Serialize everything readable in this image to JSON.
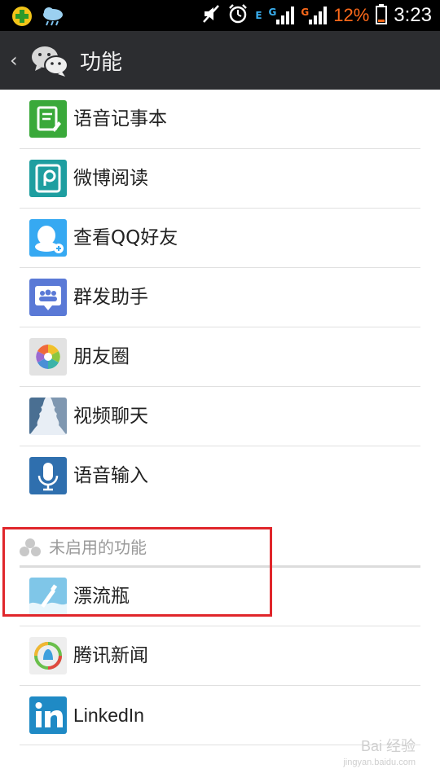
{
  "status_bar": {
    "battery_percent": "12%",
    "time": "3:23",
    "net1": "E",
    "net2": "G",
    "net3": "G",
    "icons": [
      "app-plus-icon",
      "weather-cloud-icon",
      "mute-icon",
      "alarm-icon",
      "signal-icon",
      "battery-icon"
    ],
    "battery_color": "#ff6a1a"
  },
  "action_bar": {
    "back": "‹",
    "title": "功能",
    "logo": "wechat-icon"
  },
  "features": [
    {
      "label": "语音记事本",
      "icon": "voice-notepad-icon",
      "color": "#3aa93a"
    },
    {
      "label": "微博阅读",
      "icon": "weibo-reader-icon",
      "color": "#1e9ea0"
    },
    {
      "label": "查看QQ好友",
      "icon": "qq-friends-icon",
      "color": "#36a9f2"
    },
    {
      "label": "群发助手",
      "icon": "broadcast-helper-icon",
      "color": "#5a79d6"
    },
    {
      "label": "朋友圈",
      "icon": "moments-icon",
      "color": "#e2e2e2"
    },
    {
      "label": "视频聊天",
      "icon": "video-chat-icon",
      "color": "#4a6f92"
    },
    {
      "label": "语音输入",
      "icon": "voice-input-icon",
      "color": "#2f6fae"
    }
  ],
  "disabled_section": {
    "title": "未启用的功能",
    "items": [
      {
        "label": "漂流瓶",
        "icon": "drift-bottle-icon",
        "color": "#7fc6e8"
      },
      {
        "label": "腾讯新闻",
        "icon": "tencent-news-icon",
        "color": "#eeeeee"
      },
      {
        "label": "LinkedIn",
        "icon": "linkedin-icon",
        "color": "#1f8ac5"
      }
    ]
  },
  "highlight_color": "#e0262b",
  "watermark": {
    "line1": "Bai 经验",
    "line2": "jingyan.baidu.com"
  }
}
